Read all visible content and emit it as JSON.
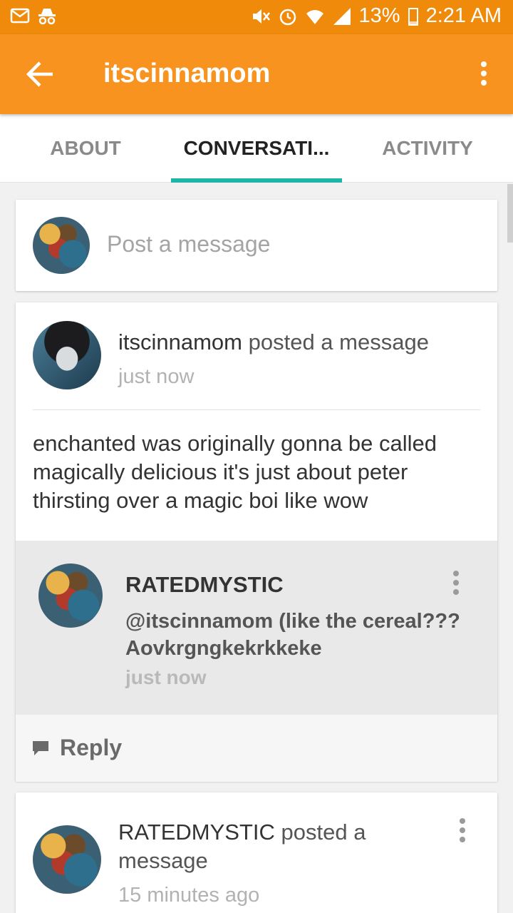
{
  "status_bar": {
    "battery": "13%",
    "time": "2:21 AM",
    "icons": [
      "mail-icon",
      "spy-icon",
      "mute-icon",
      "alarm-icon",
      "wifi-icon",
      "signal-icon",
      "battery-icon"
    ]
  },
  "app_bar": {
    "title": "itscinnamom",
    "back_icon": "arrow-back-icon",
    "menu_icon": "more-vert-icon"
  },
  "tabs": [
    {
      "label": "ABOUT",
      "active": false
    },
    {
      "label": "CONVERSATI...",
      "active": true
    },
    {
      "label": "ACTIVITY",
      "active": false
    }
  ],
  "composer": {
    "placeholder": "Post a message"
  },
  "posts": [
    {
      "user": "itscinnamom",
      "action": " posted a message",
      "time": "just now",
      "body": "enchanted was originally gonna be called magically delicious it's just about peter thirsting over a magic boi like wow",
      "reply": {
        "user": "RATEDMYSTIC",
        "text": "@itscinnamom (like the cereal??? Aovkrgngkekrkkeke",
        "time": "just now"
      },
      "reply_label": "Reply"
    },
    {
      "user": "RATEDMYSTIC",
      "action": " posted a message",
      "time": "15 minutes ago"
    }
  ],
  "colors": {
    "status_bar": "#f08a0b",
    "app_bar": "#f7931e",
    "tab_indicator": "#20b5a9"
  }
}
